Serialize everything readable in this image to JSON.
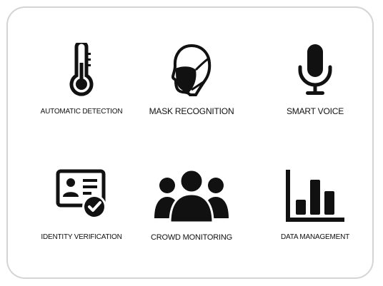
{
  "features": [
    {
      "label": "AUTOMATIC DETECTION",
      "icon": "thermometer-icon"
    },
    {
      "label": "MASK RECOGNITION",
      "icon": "face-mask-icon"
    },
    {
      "label": "SMART VOICE",
      "icon": "microphone-icon"
    },
    {
      "label": "IDENTITY VERIFICATION",
      "icon": "id-card-check-icon"
    },
    {
      "label": "CROWD MONITORING",
      "icon": "crowd-icon"
    },
    {
      "label": "DATA MANAGEMENT",
      "icon": "bar-chart-icon"
    }
  ],
  "colors": {
    "icon": "#111111",
    "border": "#d4d4d4",
    "background": "#ffffff"
  }
}
